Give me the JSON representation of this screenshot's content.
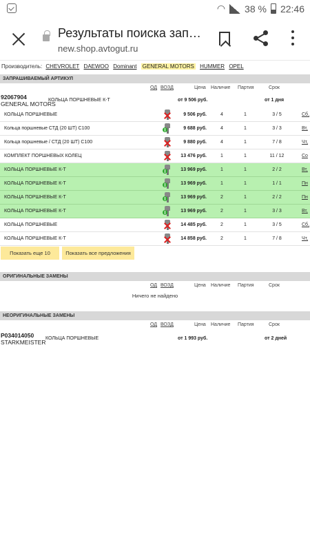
{
  "status": {
    "battery": "38 %",
    "time": "22:46"
  },
  "toolbar": {
    "title": "Результаты поиска запча...",
    "url": "new.shop.avtogut.ru"
  },
  "manufacturer": {
    "label": "Производитель:",
    "items": [
      "CHEVROLET",
      "DAEWOO",
      "Dominant",
      "GENERAL MOTORS",
      "HUMMER",
      "OPEL"
    ],
    "active": "GENERAL MOTORS"
  },
  "requested": {
    "heading": "ЗАПРАШИВАЕМЫЙ АРТИКУЛ",
    "columns": {
      "od": "ОД",
      "vozd": "ВОЗД",
      "price": "Цена",
      "avail": "Наличие",
      "batch": "Партия",
      "term": "Срок"
    },
    "article": {
      "number": "92067904",
      "maker": "GENERAL MOTORS",
      "name": "КОЛЬЦА ПОРШНЕВЫЕ К-Т",
      "price": "от 9 506 руб.",
      "term": "от 1 дня"
    },
    "rows": [
      {
        "name": "КОЛЬЦА ПОРШНЕВЫЕ",
        "price": "9 506 руб.",
        "avail": "4",
        "batch": "1",
        "term": "3 / 5",
        "day": "Сб,",
        "green": false,
        "icon": "x"
      },
      {
        "name": "Кольца поршневые СТД (20 ШТ) C100",
        "price": "9 688 руб.",
        "avail": "4",
        "batch": "1",
        "term": "3 / 3",
        "day": "Вт,",
        "green": false,
        "icon": "check"
      },
      {
        "name": "Кольца поршневые / СТД (20 ШТ) C100",
        "price": "9 880 руб.",
        "avail": "4",
        "batch": "1",
        "term": "7 / 8",
        "day": "Чт,",
        "green": false,
        "icon": "x"
      },
      {
        "name": "КОМПЛЕКТ ПОРШНЕВЫХ КОЛЕЦ",
        "price": "13 476 руб.",
        "avail": "1",
        "batch": "1",
        "term": "11 / 12",
        "day": "Со",
        "green": false,
        "icon": "x"
      },
      {
        "name": "КОЛЬЦА ПОРШНЕВЫЕ К-Т",
        "price": "13 969 руб.",
        "avail": "1",
        "batch": "1",
        "term": "2 / 2",
        "day": "Вт,",
        "green": true,
        "icon": "check"
      },
      {
        "name": "КОЛЬЦА ПОРШНЕВЫЕ К-Т",
        "price": "13 969 руб.",
        "avail": "1",
        "batch": "1",
        "term": "1 / 1",
        "day": "Пн",
        "green": true,
        "icon": "check"
      },
      {
        "name": "КОЛЬЦА ПОРШНЕВЫЕ К-Т",
        "price": "13 969 руб.",
        "avail": "2",
        "batch": "1",
        "term": "2 / 2",
        "day": "Пн",
        "green": true,
        "icon": "check"
      },
      {
        "name": "КОЛЬЦА ПОРШНЕВЫЕ К-Т",
        "price": "13 969 руб.",
        "avail": "2",
        "batch": "1",
        "term": "3 / 3",
        "day": "Вт,",
        "green": true,
        "icon": "check"
      },
      {
        "name": "КОЛЬЦА ПОРШНЕВЫЕ",
        "price": "14 485 руб.",
        "avail": "2",
        "batch": "1",
        "term": "3 / 5",
        "day": "Сб,",
        "green": false,
        "icon": "x"
      },
      {
        "name": "КОЛЬЦА ПОРШНЕВЫЕ К-Т",
        "price": "14 858 руб.",
        "avail": "2",
        "batch": "1",
        "term": "7 / 8",
        "day": "Чт,",
        "green": false,
        "icon": "x"
      }
    ],
    "buttons": {
      "more": "Показать еще 10",
      "all": "Показать все предложения"
    }
  },
  "original": {
    "heading": "ОРИГИНАЛЬНЫЕ ЗАМЕНЫ",
    "empty": "Ничего не найдено"
  },
  "nonoriginal": {
    "heading": "НЕОРИГИНАЛЬНЫЕ ЗАМЕНЫ",
    "article": {
      "number": "P034014050",
      "maker": "STARKMEISTER",
      "name": "КОЛЬЦА ПОРШНЕВЫЕ",
      "price": "от 1 993 руб.",
      "term": "от 2 дней"
    }
  },
  "colors": {
    "green_row": "#b8f0b0",
    "button": "#fde99a",
    "active_mfr": "#fdf2a0",
    "section": "#d8d8d8"
  }
}
